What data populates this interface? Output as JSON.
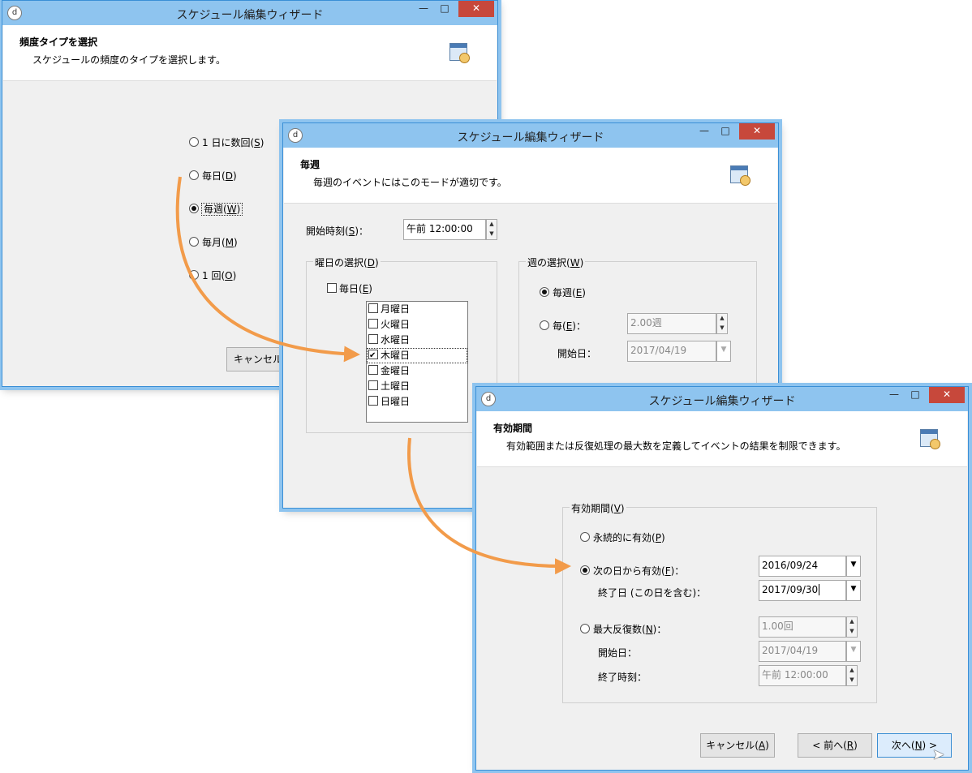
{
  "window_title": "スケジュール編集ウィザード",
  "app_icon": "dl-icon",
  "controls": {
    "minimize": "—",
    "maximize": "□",
    "close": "✕"
  },
  "win1": {
    "header_title": "頻度タイプを選択",
    "header_desc": "スケジュールの頻度のタイプを選択します。",
    "options": [
      {
        "label": "1 日に数回(",
        "key": "S",
        "selected": false
      },
      {
        "label": "毎日(",
        "key": "D",
        "selected": false
      },
      {
        "label": "毎週(",
        "key": "W",
        "selected": true
      },
      {
        "label": "毎月(",
        "key": "M",
        "selected": false
      },
      {
        "label": "1 回(",
        "key": "O",
        "selected": false
      }
    ],
    "cancel_button": "キャンセル("
  },
  "win2": {
    "header_title": "毎週",
    "header_desc": "毎週のイベントにはこのモードが適切です。",
    "start_time_label": "開始時刻(",
    "start_time_key": "S",
    "start_time_suffix": ")：",
    "start_time_value": "午前 12:00:00",
    "day_group_title": "曜日の選択(",
    "day_group_key": "D",
    "every_day_label": "毎日(",
    "every_day_key": "E",
    "days": [
      {
        "label": "月曜日",
        "checked": false
      },
      {
        "label": "火曜日",
        "checked": false
      },
      {
        "label": "水曜日",
        "checked": false
      },
      {
        "label": "木曜日",
        "checked": true
      },
      {
        "label": "金曜日",
        "checked": false
      },
      {
        "label": "土曜日",
        "checked": false
      },
      {
        "label": "日曜日",
        "checked": false
      }
    ],
    "week_group_title": "週の選択(",
    "week_group_key": "W",
    "every_week_label": "毎週(",
    "every_week_key": "E",
    "every_n_label": "毎(",
    "every_n_key": "E",
    "every_n_suffix": ")：",
    "every_n_value": "2.00週",
    "start_date_label": "開始日：",
    "start_date_value": "2017/04/19"
  },
  "win3": {
    "header_title": "有効期間",
    "header_desc": "有効範囲または反復処理の最大数を定義してイベントの結果を制限できます。",
    "group_title": "有効期間(",
    "group_key": "V",
    "permanent_label": "永続的に有効(",
    "permanent_key": "P",
    "from_date_label": "次の日から有効(",
    "from_date_key": "F",
    "from_date_suffix": ")：",
    "from_date_value": "2016/09/24",
    "end_date_label": "終了日 (この日を含む)：",
    "end_date_value": "2017/09/30",
    "max_repeat_label": "最大反復数(",
    "max_repeat_key": "N",
    "max_repeat_suffix": ")：",
    "max_repeat_value": "1.00回",
    "start_date_label": "開始日：",
    "start_date_value": "2017/04/19",
    "end_time_label": "終了時刻：",
    "end_time_value": "午前 12:00:00",
    "cancel_button": "キャンセル(",
    "cancel_key": "A",
    "back_button": "< 前へ(",
    "back_key": "R",
    "next_button": "次へ(",
    "next_key": "N",
    "next_suffix": ") >"
  },
  "colors": {
    "arrow": "#f29b4a",
    "titlebar": "#8ec4ef",
    "close": "#c7483b"
  }
}
